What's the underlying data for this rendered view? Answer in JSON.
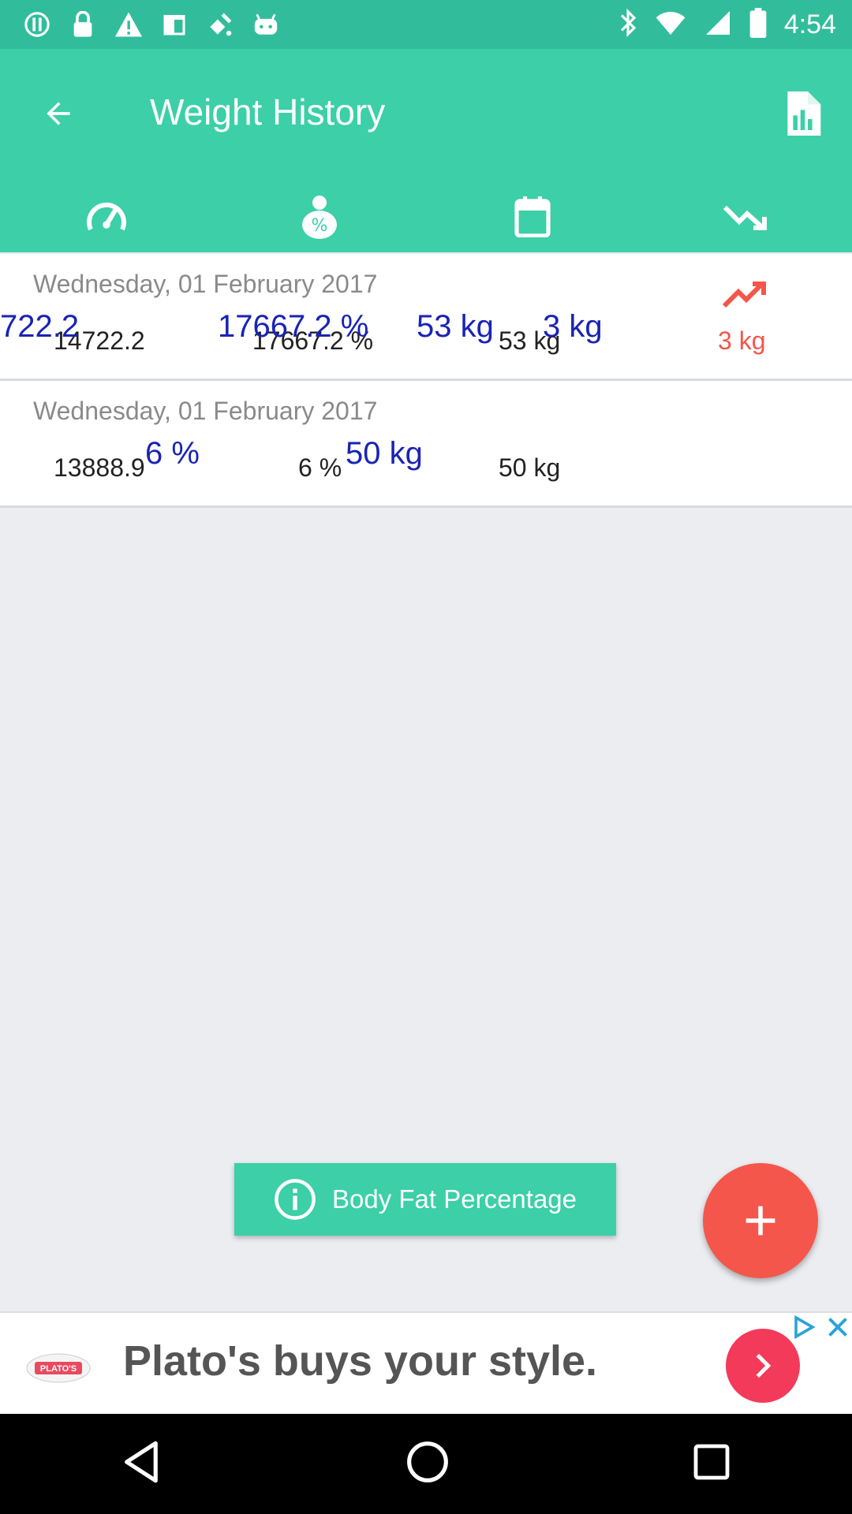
{
  "status_bar": {
    "time": "4:54",
    "icons": [
      "alert-icon",
      "lock-icon",
      "warning-icon",
      "fake-gps-icon",
      "satellite-icon",
      "android-icon",
      "bluetooth-icon",
      "wifi-icon",
      "signal-icon",
      "battery-icon"
    ]
  },
  "app_bar": {
    "title": "Weight History",
    "back_icon": "arrow-back-icon",
    "report_icon": "report-chart-icon"
  },
  "tabs": [
    {
      "icon": "speedometer-icon"
    },
    {
      "icon": "body-fat-percent-icon"
    },
    {
      "icon": "calendar-icon"
    },
    {
      "icon": "trending-down-icon"
    }
  ],
  "records": [
    {
      "date": "Wednesday, 01 February 2017",
      "values": [
        "14722.2",
        "17667.2 %",
        "53 kg"
      ],
      "overlay": [
        "722.2",
        "17667.2 %",
        "53 kg",
        "3 kg"
      ],
      "change": "3 kg",
      "trend": "trending-up-icon"
    },
    {
      "date": "Wednesday, 01 February 2017",
      "values": [
        "13888.9",
        "6 %",
        "50 kg"
      ],
      "overlay": [
        "6 %",
        "50 kg"
      ]
    }
  ],
  "info_button": {
    "label": "Body Fat Percentage",
    "icon": "info-icon"
  },
  "fab": {
    "icon": "plus-icon"
  },
  "ad": {
    "headline": "Plato's buys your style.",
    "logo_text": "PLATO'S"
  },
  "colors": {
    "primary": "#3ccfa8",
    "status": "#31bd9b",
    "accent": "#f4564b",
    "overlay_text": "#1a23b5"
  }
}
